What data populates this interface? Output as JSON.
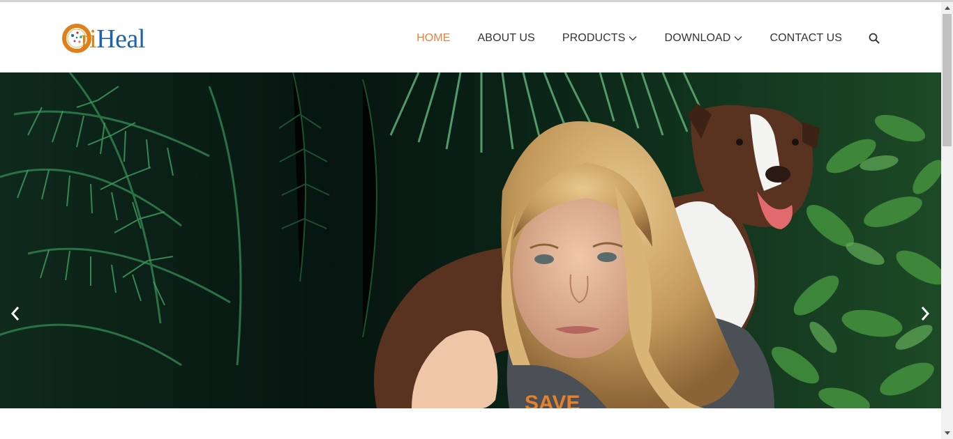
{
  "brand": {
    "logo_letter": "O",
    "logo_ri": "ri",
    "logo_heal": "Heal",
    "colors": {
      "orange": "#e0801b",
      "blue": "#1e62a8"
    }
  },
  "nav": {
    "items": [
      {
        "label": "HOME",
        "active": true,
        "dropdown": false
      },
      {
        "label": "ABOUT US",
        "active": false,
        "dropdown": false
      },
      {
        "label": "PRODUCTS",
        "active": false,
        "dropdown": true
      },
      {
        "label": "DOWNLOAD",
        "active": false,
        "dropdown": true
      },
      {
        "label": "CONTACT US",
        "active": false,
        "dropdown": false
      }
    ],
    "search_icon": "search-icon",
    "active_color": "#e8823a"
  },
  "hero": {
    "shirt_text": "SAVE",
    "prev_icon": "chevron-left-icon",
    "next_icon": "chevron-right-icon"
  }
}
